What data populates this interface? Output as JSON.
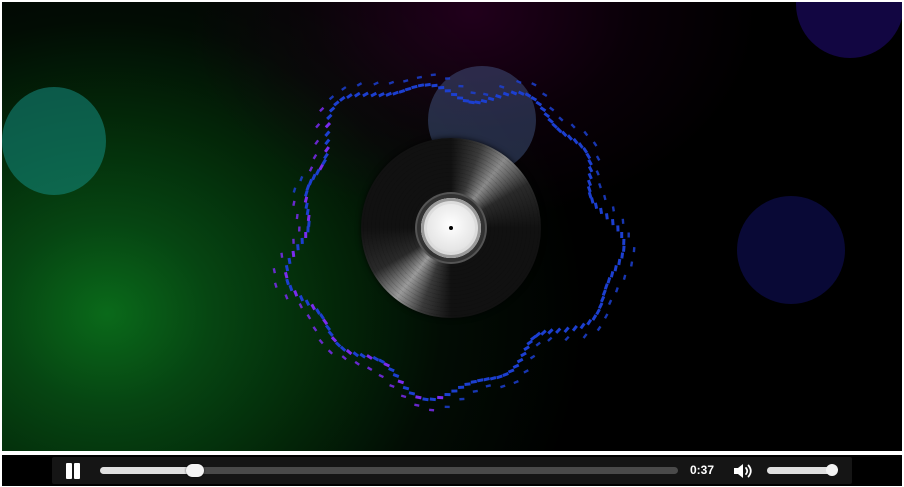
{
  "player": {
    "state": "playing",
    "current_time": "0:37",
    "progress_fraction": 0.165,
    "volume_fraction": 0.95
  },
  "icons": {
    "play_pause": "pause-icon",
    "volume": "volume-icon",
    "disc": "vinyl-record-icon"
  },
  "colors": {
    "visualizer_primary": "#1c3fd0",
    "visualizer_accent": "#7a2cf0",
    "background_glow": "#0a6a1a",
    "controls_bg": "#151515",
    "progress_fill": "#e0e0e0"
  }
}
